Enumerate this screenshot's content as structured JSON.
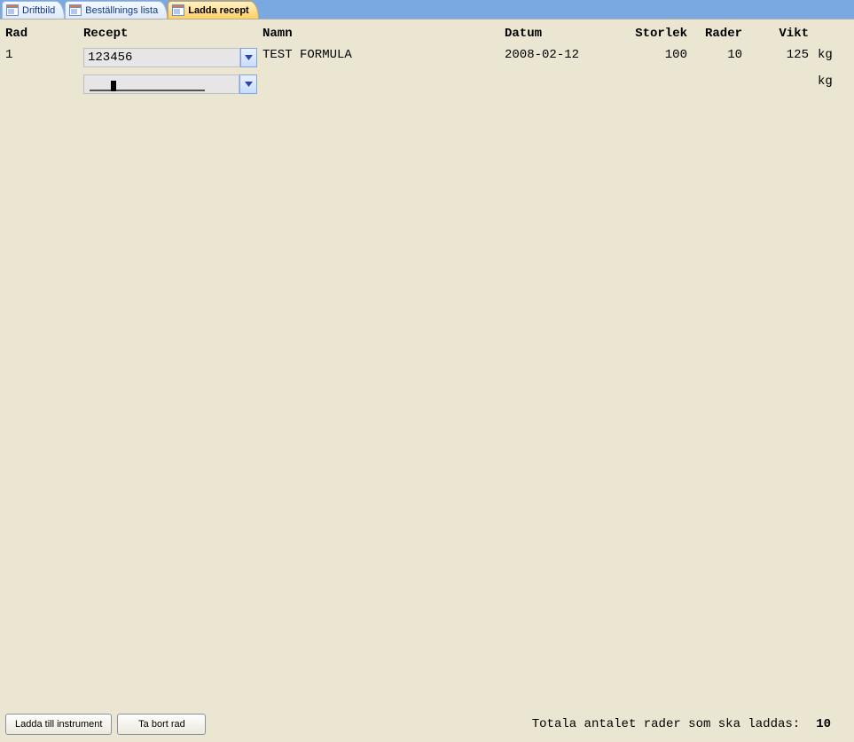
{
  "tabs": [
    {
      "label": "Driftbild",
      "active": false
    },
    {
      "label": "Beställnings lista",
      "active": false
    },
    {
      "label": "Ladda recept",
      "active": true
    }
  ],
  "columns": {
    "rad": "Rad",
    "recept": "Recept",
    "namn": "Namn",
    "datum": "Datum",
    "storlek": "Storlek",
    "rader": "Rader",
    "vikt": "Vikt"
  },
  "rows": [
    {
      "rad": "1",
      "recept": "123456",
      "namn": "TEST FORMULA",
      "datum": "2008-02-12",
      "storlek": "100",
      "rader": "10",
      "vikt": "125",
      "unit": "kg"
    },
    {
      "rad": "",
      "recept": "",
      "namn": "",
      "datum": "",
      "storlek": "",
      "rader": "",
      "vikt": "",
      "unit": "kg"
    }
  ],
  "footer": {
    "btn_load": "Ladda till instrument",
    "btn_delete": "Ta bort rad",
    "total_label": "Totala antalet rader som ska laddas:",
    "total_value": "10"
  }
}
